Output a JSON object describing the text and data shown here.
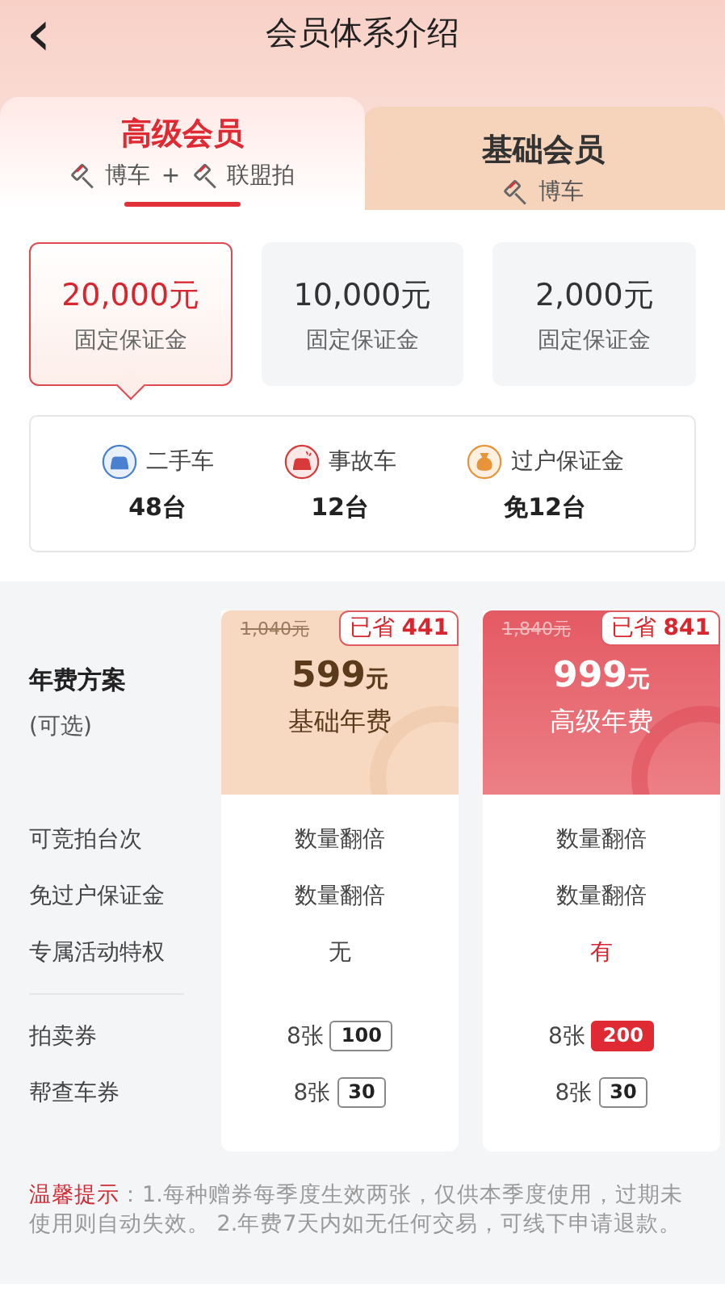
{
  "header": {
    "back": "‹",
    "title": "会员体系介绍"
  },
  "tabs": [
    {
      "title": "高级会员",
      "selected": true,
      "platforms": [
        "博车",
        "联盟拍"
      ],
      "joiner": "+"
    },
    {
      "title": "基础会员",
      "selected": false,
      "platforms": [
        "博车"
      ]
    }
  ],
  "deposits": [
    {
      "amount": "20,000元",
      "label": "固定保证金",
      "selected": true
    },
    {
      "amount": "10,000元",
      "label": "固定保证金",
      "selected": false
    },
    {
      "amount": "2,000元",
      "label": "固定保证金",
      "selected": false
    }
  ],
  "stats": [
    {
      "kind": "used-car",
      "label": "二手车",
      "value": "48台"
    },
    {
      "kind": "accident-car",
      "label": "事故车",
      "value": "12台"
    },
    {
      "kind": "deposit",
      "label": "过户保证金",
      "value": "免12台"
    }
  ],
  "plans": {
    "title": "年费方案",
    "subtitle": "(可选)",
    "columns": [
      {
        "kind": "basic",
        "original": "1,040元",
        "saved_label": "已省",
        "saved": "441",
        "price": "599",
        "unit": "元",
        "name": "基础年费"
      },
      {
        "kind": "premium",
        "original": "1,840元",
        "saved_label": "已省",
        "saved": "841",
        "price": "999",
        "unit": "元",
        "name": "高级年费"
      }
    ],
    "rows": [
      {
        "label": "可竞拍台次",
        "values": [
          {
            "text": "数量翻倍",
            "highlight": false
          },
          {
            "text": "数量翻倍",
            "highlight": false
          }
        ]
      },
      {
        "label": "免过户保证金",
        "values": [
          {
            "text": "数量翻倍",
            "highlight": false
          },
          {
            "text": "数量翻倍",
            "highlight": false
          }
        ]
      },
      {
        "label": "专属活动特权",
        "values": [
          {
            "text": "无",
            "highlight": false
          },
          {
            "text": "有",
            "highlight": true
          }
        ]
      }
    ],
    "vouchers": [
      {
        "label": "拍卖券",
        "values": [
          {
            "count": "8张",
            "amount": "100",
            "highlight": false
          },
          {
            "count": "8张",
            "amount": "200",
            "highlight": true
          }
        ]
      },
      {
        "label": "帮查车券",
        "values": [
          {
            "count": "8张",
            "amount": "30",
            "highlight": false
          },
          {
            "count": "8张",
            "amount": "30",
            "highlight": false
          }
        ]
      }
    ]
  },
  "tip": {
    "label": "温馨提示",
    "text": "：1.每种赠券每季度生效两张，仅供本季度使用，过期未使用则自动失效。 2.年费7天内如无任何交易，可线下申请退款。"
  }
}
